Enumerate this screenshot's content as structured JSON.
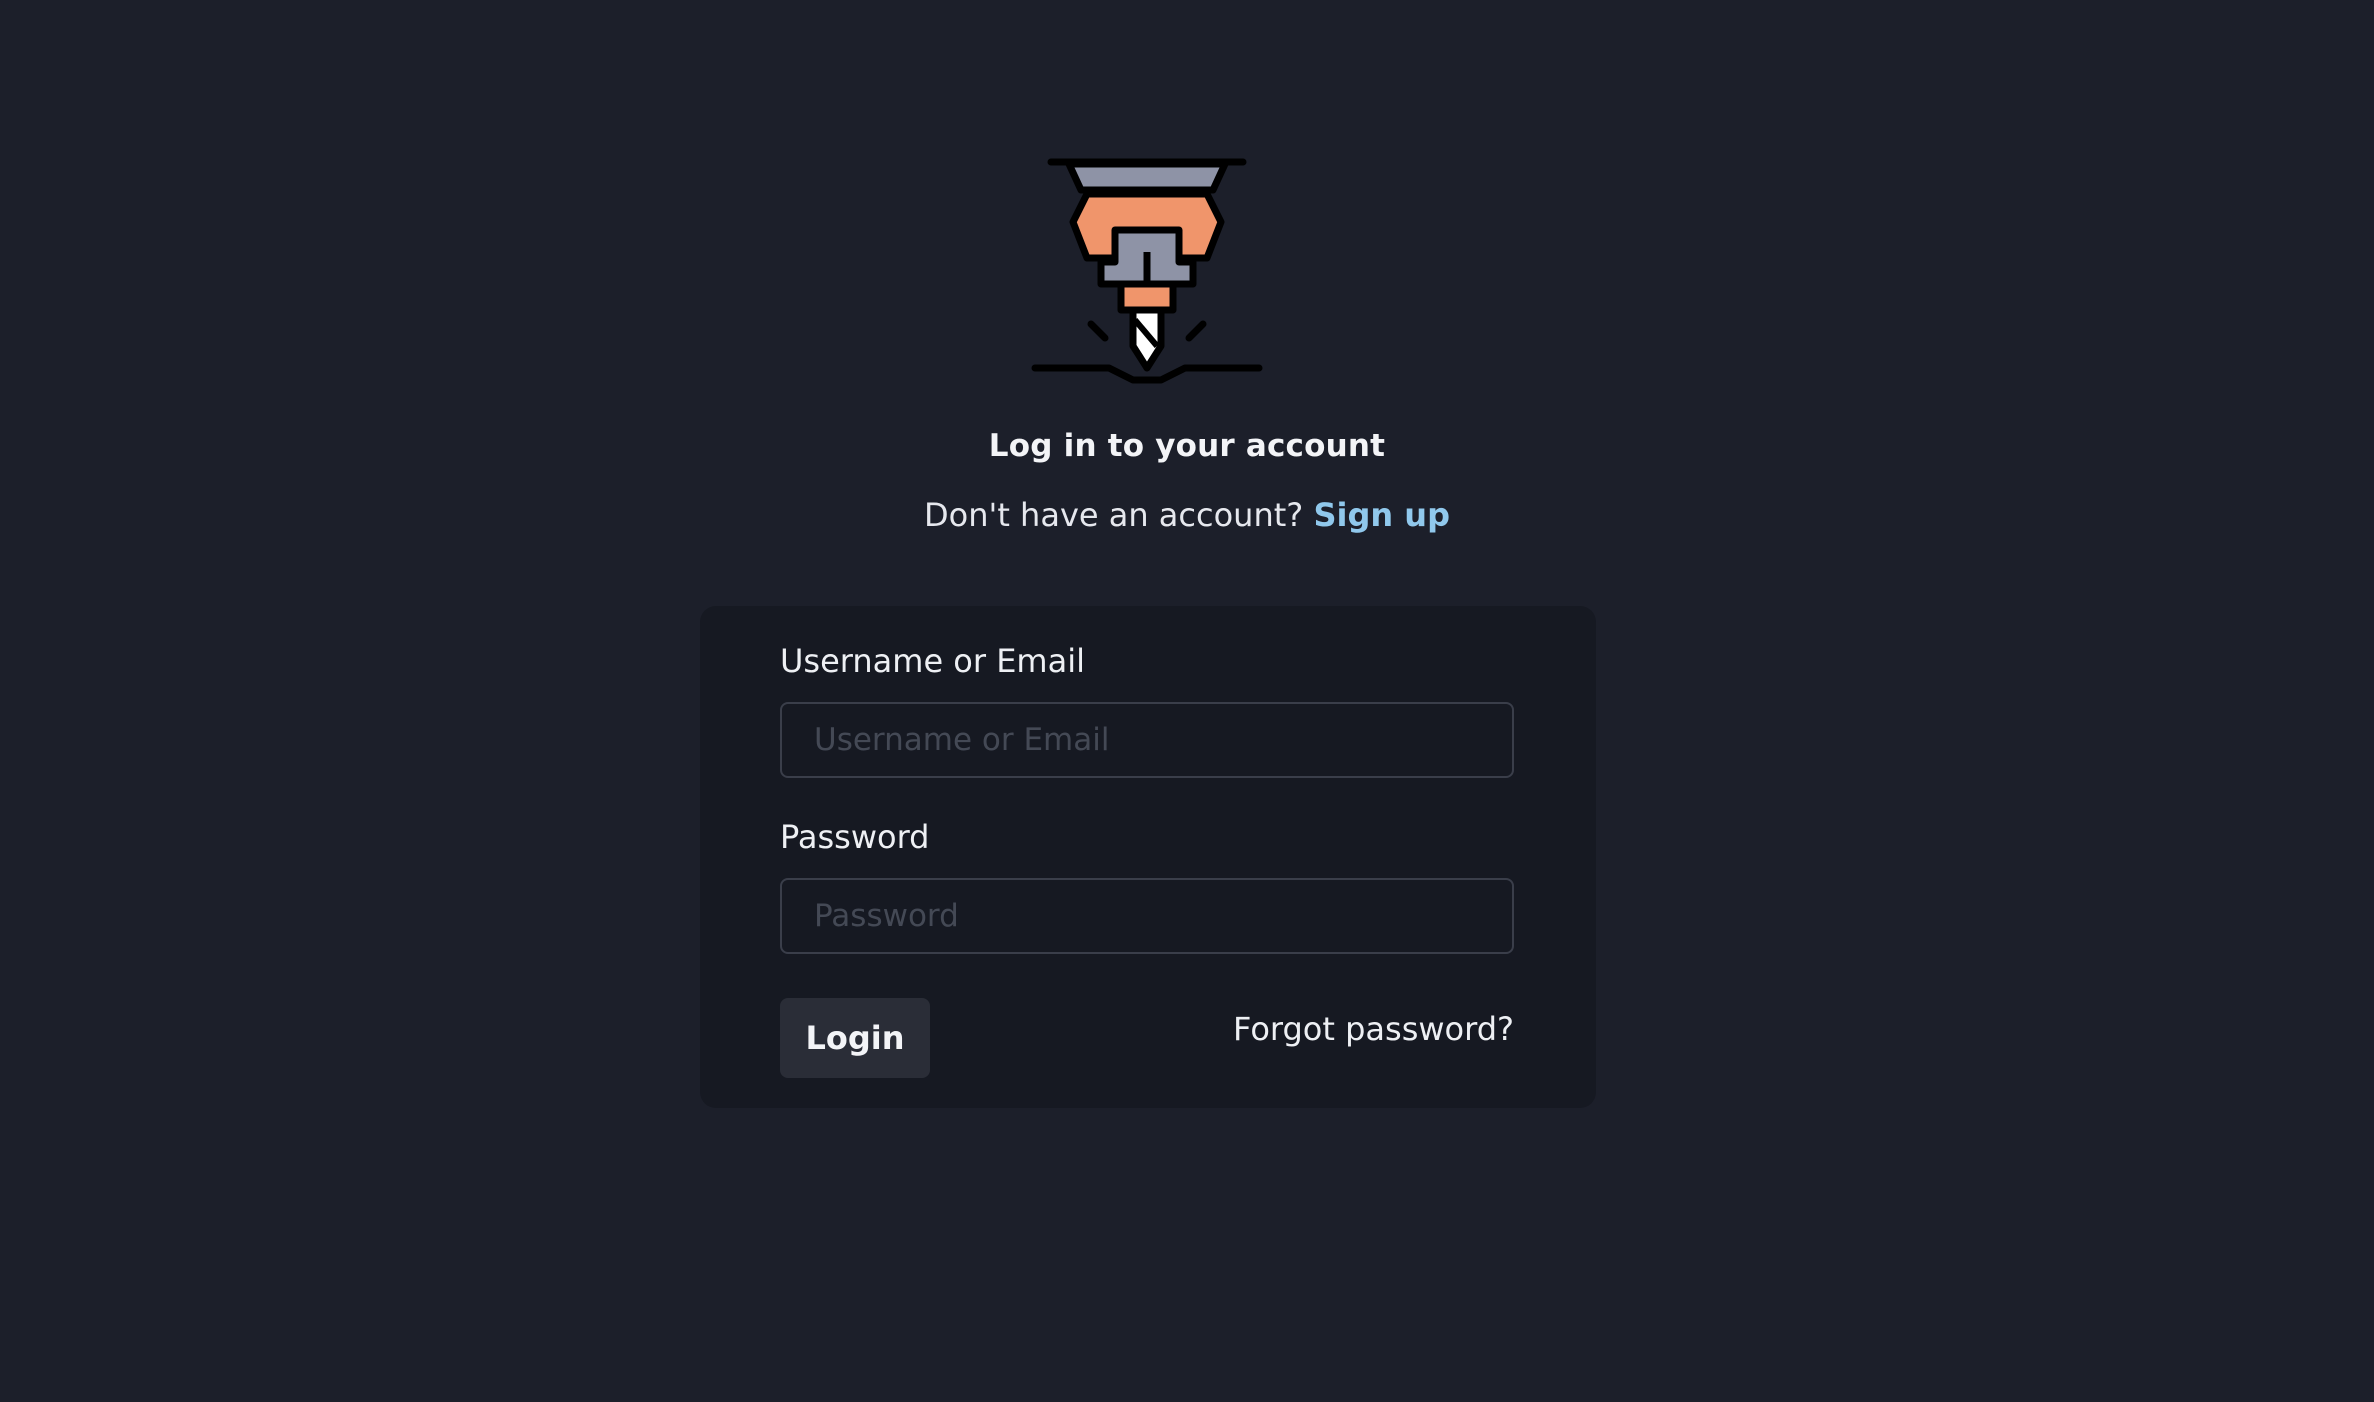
{
  "logo": {
    "icon": "jackhammer-drill-icon",
    "colors": {
      "orange": "#f0956b",
      "gray": "#8e93a6",
      "outline": "#000000"
    }
  },
  "header": {
    "title": "Log in to your account",
    "signup_prompt": "Don't have an account?",
    "signup_link": "Sign up"
  },
  "form": {
    "username": {
      "label": "Username or Email",
      "placeholder": "Username or Email",
      "value": ""
    },
    "password": {
      "label": "Password",
      "placeholder": "Password",
      "value": ""
    },
    "login_label": "Login",
    "forgot_label": "Forgot password?"
  },
  "colors": {
    "background": "#1c1f2a",
    "card": "#161922",
    "link": "#90c8ec",
    "button": "#2a2d37"
  }
}
